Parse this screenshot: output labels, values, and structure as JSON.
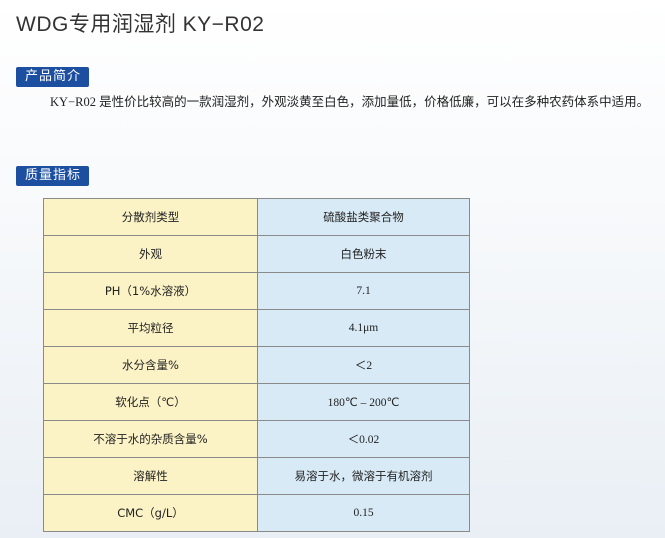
{
  "page": {
    "title": "WDG专用润湿剂  KY−R02"
  },
  "sections": {
    "intro_label": "产品简介",
    "intro_text": "KY−R02 是性价比较高的一款润湿剂，外观淡黄至白色，添加量低，价格低廉，可以在多种农药体系中适用。",
    "spec_label": "质量指标"
  },
  "spec_table": {
    "rows": [
      {
        "key": "分散剂类型",
        "value": "硫酸盐类聚合物"
      },
      {
        "key": "外观",
        "value": "白色粉末"
      },
      {
        "key": "PH（1%水溶液）",
        "value": "7.1"
      },
      {
        "key": "平均粒径",
        "value": "4.1μm"
      },
      {
        "key": "水分含量%",
        "value": "＜2"
      },
      {
        "key": "软化点（℃）",
        "value": "180℃ – 200℃"
      },
      {
        "key": "不溶于水的杂质含量%",
        "value": "＜0.02"
      },
      {
        "key": "溶解性",
        "value": "易溶于水，微溶于有机溶剂"
      },
      {
        "key": "CMC（g/L）",
        "value": "0.15"
      }
    ]
  },
  "colors": {
    "label_bg": "#1d4fa0",
    "key_cell_bg": "#fbf3c6",
    "value_cell_bg": "#d8eaf6"
  }
}
